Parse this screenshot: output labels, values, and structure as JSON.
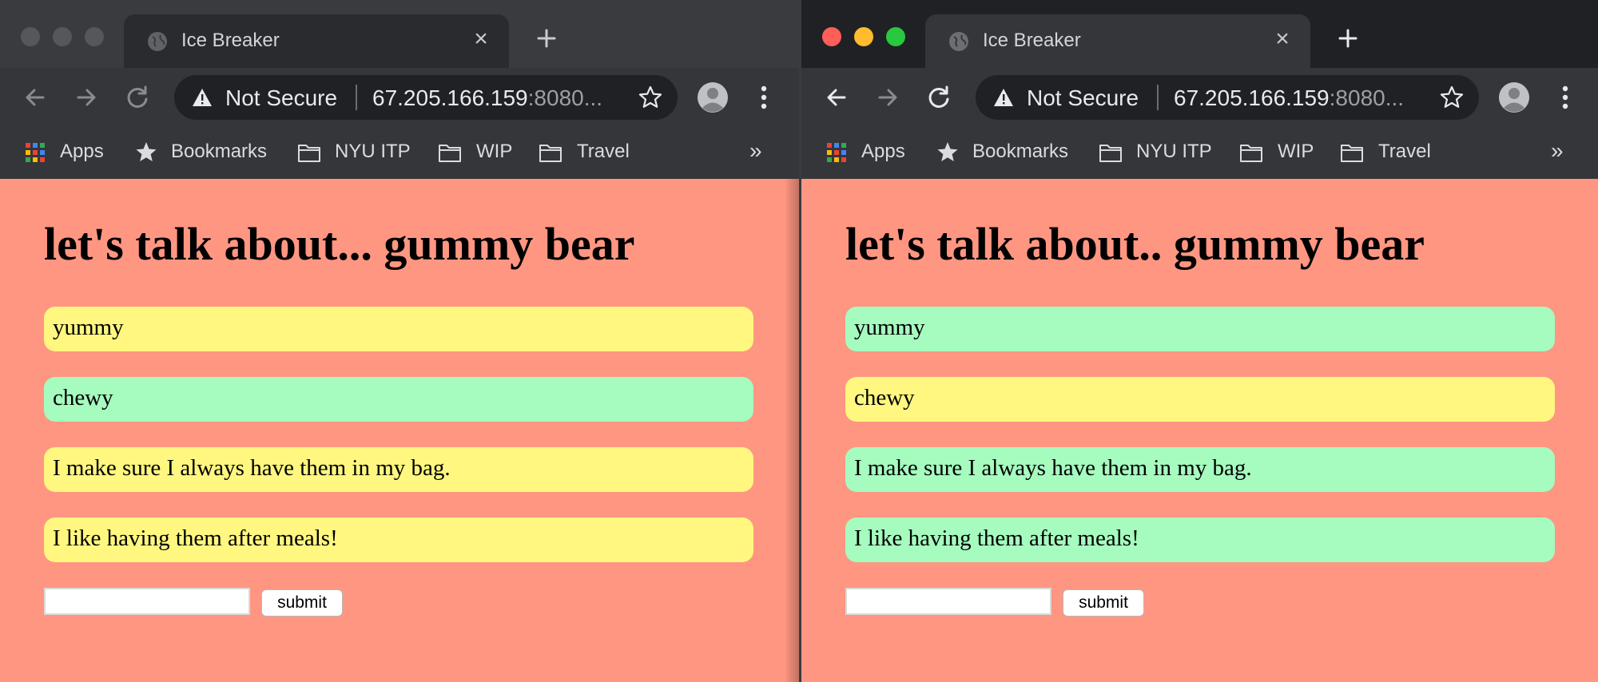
{
  "colors": {
    "page_background": "#ff9682",
    "pill_yellow": "#fff780",
    "pill_green": "#a6fbbf"
  },
  "windows": [
    {
      "tab_title": "Ice Breaker",
      "address": {
        "security": "Not Secure",
        "host": "67.205.166.159",
        "port_trunc": ":8080..."
      },
      "bookmarks": [
        {
          "label": "Apps",
          "icon": "apps-grid-icon"
        },
        {
          "label": "Bookmarks",
          "icon": "star-icon"
        },
        {
          "label": "NYU ITP",
          "icon": "folder-icon"
        },
        {
          "label": "WIP",
          "icon": "folder-icon"
        },
        {
          "label": "Travel",
          "icon": "folder-icon"
        }
      ],
      "bookmarks_more": "»",
      "page": {
        "heading": "let's talk about... gummy bear",
        "items": [
          {
            "text": "yummy",
            "color": "#fff780"
          },
          {
            "text": "chewy",
            "color": "#a6fbbf"
          },
          {
            "text": "I make sure I always have them in my bag.",
            "color": "#fff780"
          },
          {
            "text": "I like having them after meals!",
            "color": "#fff780"
          }
        ],
        "input_value": "",
        "submit_label": "submit"
      }
    },
    {
      "tab_title": "Ice Breaker",
      "address": {
        "security": "Not Secure",
        "host": "67.205.166.159",
        "port_trunc": ":8080..."
      },
      "bookmarks": [
        {
          "label": "Apps",
          "icon": "apps-grid-icon"
        },
        {
          "label": "Bookmarks",
          "icon": "star-icon"
        },
        {
          "label": "NYU ITP",
          "icon": "folder-icon"
        },
        {
          "label": "WIP",
          "icon": "folder-icon"
        },
        {
          "label": "Travel",
          "icon": "folder-icon"
        }
      ],
      "bookmarks_more": "»",
      "page": {
        "heading": "let's talk about.. gummy bear",
        "items": [
          {
            "text": "yummy",
            "color": "#a6fbbf"
          },
          {
            "text": "chewy",
            "color": "#fff780"
          },
          {
            "text": "I make sure I always have them in my bag.",
            "color": "#a6fbbf"
          },
          {
            "text": "I like having them after meals!",
            "color": "#a6fbbf"
          }
        ],
        "input_value": "",
        "submit_label": "submit"
      }
    }
  ]
}
